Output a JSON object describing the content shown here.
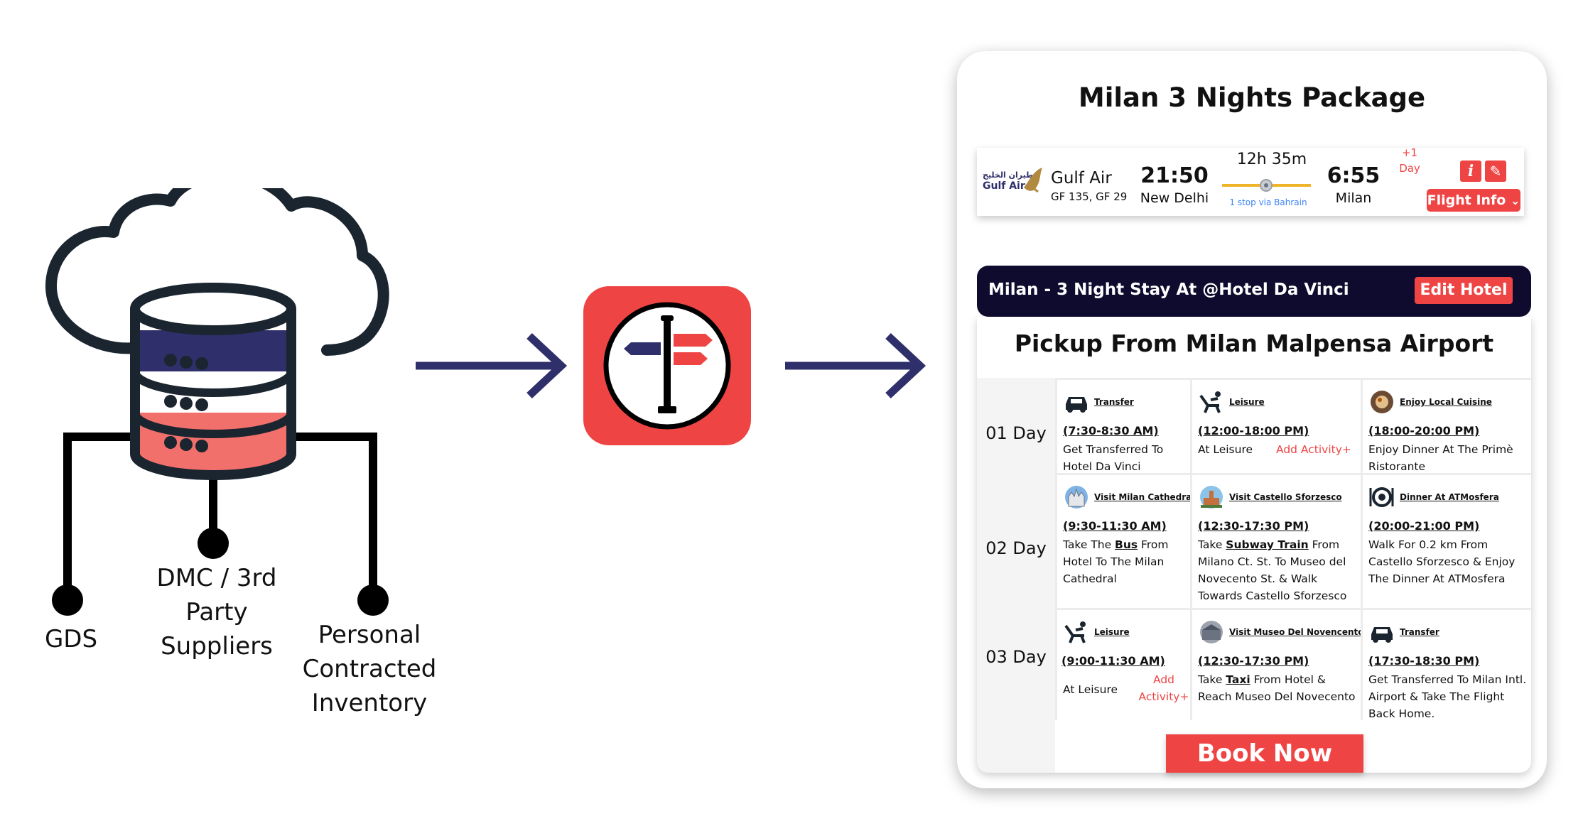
{
  "sources": {
    "gds": "GDS",
    "dmc": [
      "DMC / 3rd",
      "Party",
      "Suppliers"
    ],
    "personal": [
      "Personal",
      "Contracted",
      "Inventory"
    ]
  },
  "colors": {
    "navy": "#2f2f6b",
    "red": "#ef4444",
    "dark": "#0f0b2e",
    "outline": "#1b2530",
    "coral": "#f2706c"
  },
  "icons": {
    "cloud": "cloud-database-icon",
    "app": "signpost-app-icon"
  },
  "package": {
    "title": "Milan 3 Nights Package",
    "flight": {
      "airline_logo_ar": "طيران الخليج",
      "airline_logo_en": "Gulf Air",
      "airline": "Gulf Air",
      "flight_numbers": "GF 135, GF 29",
      "depart_time": "21:50",
      "depart_city": "New Delhi",
      "duration": "12h 35m",
      "stops": "1 stop via Bahrain",
      "arrive_time": "6:55",
      "arrive_city": "Milan",
      "day_offset_1": "+1",
      "day_offset_2": "Day",
      "info_glyph": "i",
      "edit_glyph": "✎",
      "flight_info_label": "Flight Info",
      "chevron": "⌄"
    },
    "stay_title": "Milan - 3 Night Stay At @Hotel Da Vinci",
    "edit_hotel_label": "Edit Hotel",
    "pickup_title": "Pickup From Milan Malpensa Airport",
    "days": [
      {
        "label": "01 Day",
        "activities": [
          {
            "caption": "Transfer",
            "icon": "car-icon",
            "time": "(7:30-8:30 AM)",
            "desc": "Get Transferred To Hotel Da Vinci"
          },
          {
            "caption": "Leisure",
            "icon": "lounge-chair-icon",
            "time": "(12:00-18:00 PM)",
            "desc": "At Leisure",
            "add": "Add Activity+"
          },
          {
            "caption": "Enjoy Local Cuisine",
            "icon": "cuisine-photo-icon",
            "time": "(18:00-20:00 PM)",
            "desc": "Enjoy Dinner At The Primè Ristorante"
          }
        ]
      },
      {
        "label": "02 Day",
        "activities": [
          {
            "caption": "Visit Milan Cathedral",
            "icon": "cathedral-photo-icon",
            "time": "(9:30-11:30 AM)",
            "desc_pre": "Take The ",
            "desc_bold": "Bus",
            "desc_post": " From Hotel To The Milan Cathedral"
          },
          {
            "caption": "Visit Castello Sforzesco",
            "icon": "castle-photo-icon",
            "time": "(12:30-17:30 PM)",
            "desc_pre": "Take ",
            "desc_bold": "Subway Train",
            "desc_post": " From Milano Ct. St. To Museo del Novecento St. & Walk Towards Castello Sforzesco"
          },
          {
            "caption": "Dinner At ATMosfera",
            "icon": "dinner-plate-icon",
            "time": "(20:00-21:00 PM)",
            "desc": "Walk For 0.2 km From Castello Sforzesco & Enjoy The Dinner At ATMosfera"
          }
        ]
      },
      {
        "label": "03 Day",
        "activities": [
          {
            "caption": "Leisure",
            "icon": "lounge-chair-icon",
            "time": "(9:00-11:30 AM)",
            "desc": "At Leisure",
            "add": "Add Activity+"
          },
          {
            "caption": "Visit Museo Del Novencento",
            "icon": "museum-photo-icon",
            "time": "(12:30-17:30 PM)",
            "desc_pre": "Take ",
            "desc_bold": "Taxi",
            "desc_post": " From Hotel & Reach Museo Del Novecento"
          },
          {
            "caption": "Transfer",
            "icon": "car-icon",
            "time": "(17:30-18:30 PM)",
            "desc": "Get Transferred To Milan Intl. Airport & Take The Flight Back Home."
          }
        ]
      }
    ],
    "book_now_label": "Book Now"
  }
}
